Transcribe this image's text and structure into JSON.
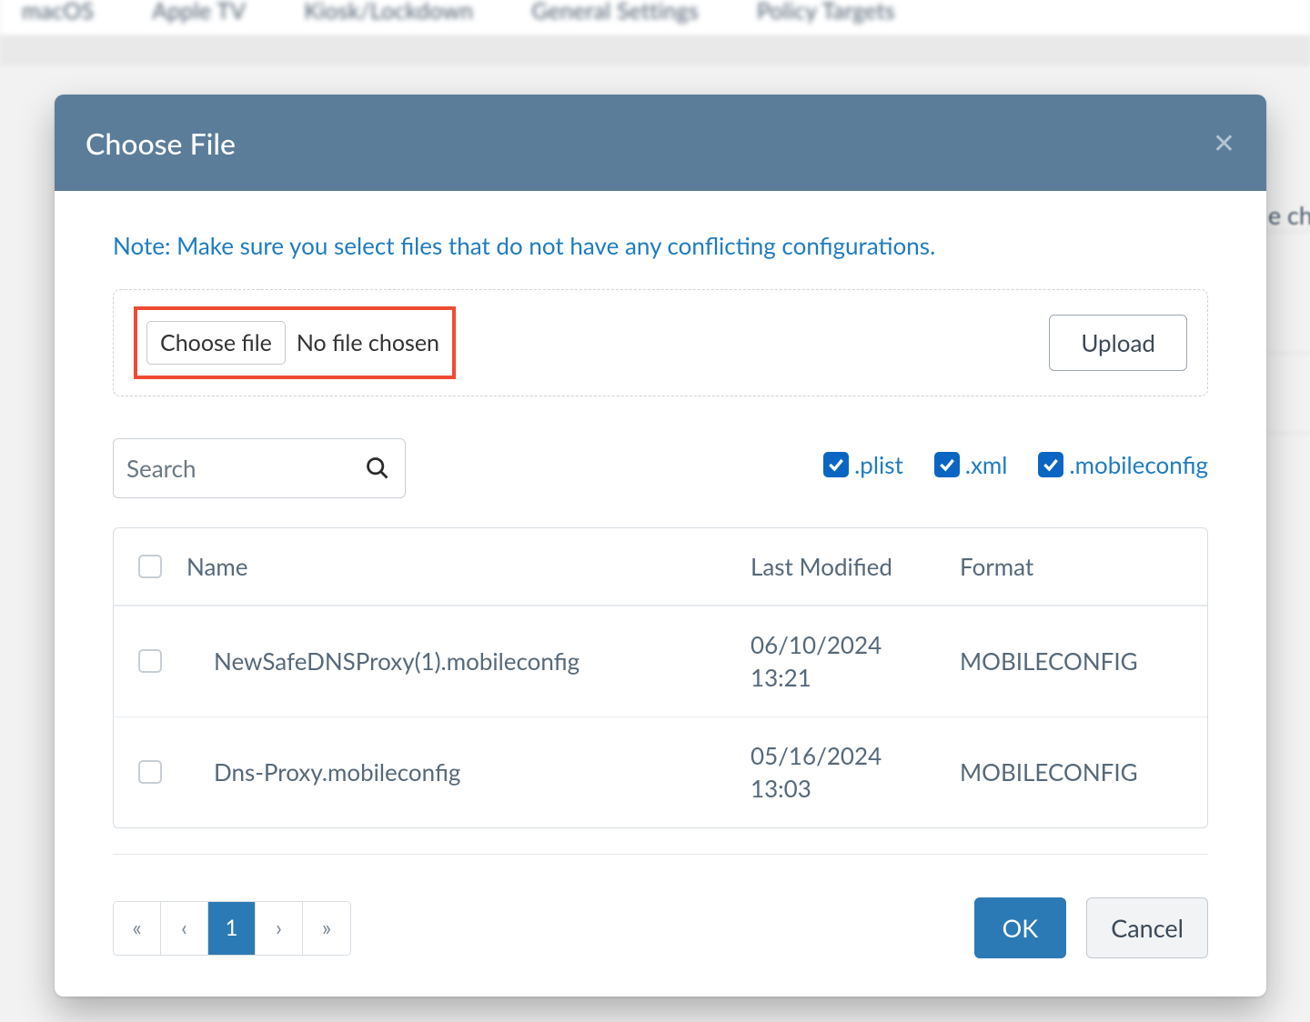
{
  "background": {
    "tabs": [
      "macOS",
      "Apple TV",
      "Kiosk/Lockdown",
      "General Settings",
      "Policy Targets"
    ],
    "right_cut_text": "e chos"
  },
  "modal": {
    "title": "Choose File",
    "note": "Note: Make sure you select files that do not have any conflicting configurations.",
    "choose_label": "Choose file",
    "no_file_label": "No file chosen",
    "upload_label": "Upload",
    "search_placeholder": "Search",
    "filters": {
      "plist": ".plist",
      "xml": ".xml",
      "mobileconfig": ".mobileconfig"
    },
    "columns": {
      "name": "Name",
      "modified": "Last Modified",
      "format": "Format"
    },
    "rows": [
      {
        "name": "NewSafeDNSProxy(1).mobileconfig",
        "modified_date": "06/10/2024",
        "modified_time": "13:21",
        "format": "MOBILECONFIG"
      },
      {
        "name": "Dns-Proxy.mobileconfig",
        "modified_date": "05/16/2024",
        "modified_time": "13:03",
        "format": "MOBILECONFIG"
      }
    ],
    "pager": {
      "first": "«",
      "prev": "‹",
      "page": "1",
      "next": "›",
      "last": "»"
    },
    "actions": {
      "ok": "OK",
      "cancel": "Cancel"
    }
  }
}
